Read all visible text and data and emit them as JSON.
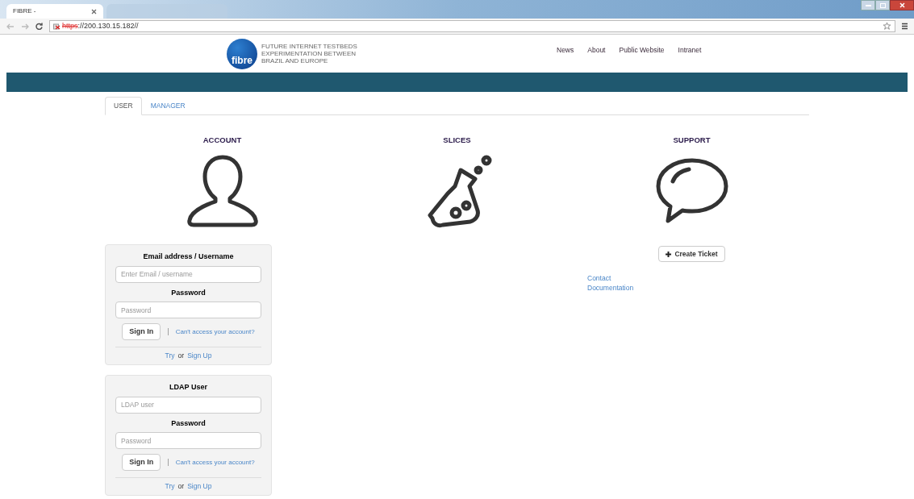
{
  "browser": {
    "tabs": [
      {
        "title": "FIBRE -",
        "selected": true
      },
      {
        "selected": false
      }
    ],
    "address": {
      "scheme": "https",
      "rest": "://200.130.15.182//"
    }
  },
  "header": {
    "logo_word": "fibre",
    "tagline": [
      "FUTURE INTERNET TESTBEDS",
      "EXPERIMENTATION BETWEEN",
      "BRAZIL AND EUROPE"
    ],
    "nav": [
      "News",
      "About",
      "Public Website",
      "Intranet"
    ]
  },
  "tabs": [
    {
      "label": "USER",
      "selected": true
    },
    {
      "label": "MANAGER",
      "selected": false
    }
  ],
  "columns": [
    {
      "title": "ACCOUNT",
      "kind": "account"
    },
    {
      "title": "SLICES",
      "kind": "slices"
    },
    {
      "title": "SUPPORT",
      "kind": "support"
    }
  ],
  "login_forms": [
    {
      "user_label": "Email address / Username",
      "user_placeholder": "Enter Email / username",
      "password_label": "Password",
      "password_placeholder": "Password",
      "button": "Sign In",
      "separator": "|",
      "help_link": "Can't access your account?",
      "try": "Try",
      "or": "or",
      "signup": "Sign Up"
    },
    {
      "user_label": "LDAP User",
      "user_placeholder": "LDAP user",
      "password_label": "Password",
      "password_placeholder": "Password",
      "button": "Sign In",
      "separator": "|",
      "help_link": "Can't access your account?",
      "try": "Try",
      "or": "or",
      "signup": "Sign Up"
    }
  ],
  "support": {
    "button": "Create Ticket",
    "links": [
      "Contact",
      "Documentation"
    ]
  }
}
